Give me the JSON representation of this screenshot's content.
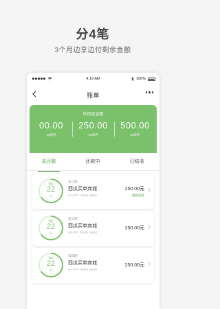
{
  "promo": {
    "title": "分4笔",
    "subtitle": "3个月边享边付剩余金额"
  },
  "statusbar": {
    "time": "4:19 AM",
    "battery": "100%"
  },
  "nav": {
    "title": "账单"
  },
  "summary": {
    "label": "待还款金额",
    "columns": [
      {
        "amount": "00.00",
        "days": "30日内"
      },
      {
        "amount": "250.00",
        "days": "60日内"
      },
      {
        "amount": "500.00",
        "days": "90日内"
      }
    ]
  },
  "tabs": [
    {
      "label": "未还款"
    },
    {
      "label": "还款中"
    },
    {
      "label": "已结清"
    }
  ],
  "bills": [
    {
      "ring_top": "剩余",
      "ring_num": "22",
      "ring_bot": "天",
      "period": "第二期",
      "merchant": "西瓜买单商城",
      "card": "HAPPY 8888 8888",
      "amount": "250.00元",
      "status": "最新还款"
    },
    {
      "ring_top": "剩余",
      "ring_num": "22",
      "ring_bot": "天",
      "period": "第三期",
      "merchant": "西瓜买单商城",
      "card": "HAPPY 8888 8888",
      "amount": "250.00元",
      "status": ""
    },
    {
      "ring_top": "剩余",
      "ring_num": "22",
      "ring_bot": "天",
      "period": "第四期",
      "merchant": "西瓜买单商城",
      "card": "HAPPY 8888 8888",
      "amount": "250.00元",
      "status": ""
    }
  ],
  "colors": {
    "accent": "#7bc06a",
    "accent_dark": "#5aa64a",
    "background": "#f4f5f4"
  }
}
